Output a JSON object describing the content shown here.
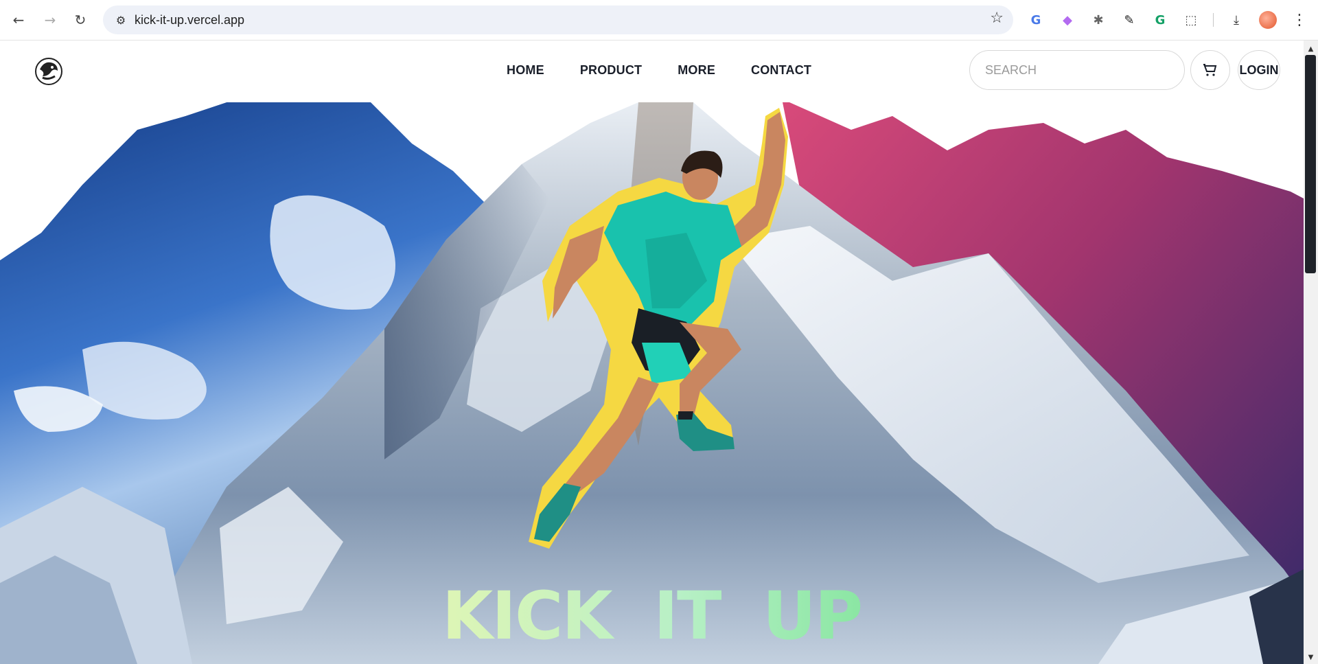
{
  "browser": {
    "back_icon": "←",
    "forward_icon": "→",
    "reload_icon": "↻",
    "site_info_icon": "⚙",
    "url": "kick-it-up.vercel.app",
    "bookmark_icon": "☆",
    "extensions": [
      {
        "name": "google-translate-icon",
        "glyph": "G",
        "color": "#4a7ae8"
      },
      {
        "name": "pen-extension-icon",
        "glyph": "◆",
        "color": "#b36bf0"
      },
      {
        "name": "bug-extension-icon",
        "glyph": "✱",
        "color": "#666666"
      },
      {
        "name": "eyedropper-icon",
        "glyph": "✎",
        "color": "#222222"
      },
      {
        "name": "grammarly-icon",
        "glyph": "G",
        "color": "#15a167"
      },
      {
        "name": "puzzle-extensions-icon",
        "glyph": "⬚",
        "color": "#444444"
      },
      {
        "name": "download-icon",
        "glyph": "⤓",
        "color": "#333333"
      }
    ],
    "menu_icon": "⋮"
  },
  "header": {
    "nav": [
      {
        "label": "HOME"
      },
      {
        "label": "PRODUCT"
      },
      {
        "label": "MORE"
      },
      {
        "label": "CONTACT"
      }
    ],
    "search_placeholder": "SEARCH",
    "login_label": "LOGIN"
  },
  "hero": {
    "title_words": [
      "KICK",
      "IT",
      "UP"
    ],
    "colors": {
      "left_mountain": "#2d5fb0",
      "right_mountain": "#b23a6a",
      "center_mountain": "#cfd8e3",
      "shirt": "#19c2ad",
      "outline": "#f5d842"
    }
  }
}
